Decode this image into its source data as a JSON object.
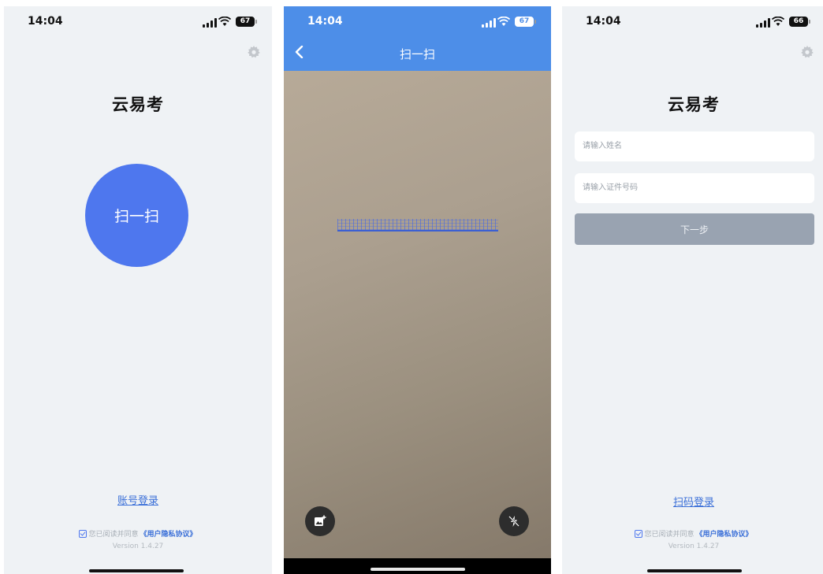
{
  "status_bar": [
    {
      "time": "14:04",
      "battery": "67"
    },
    {
      "time": "14:04",
      "battery": "67"
    },
    {
      "time": "14:04",
      "battery": "66"
    }
  ],
  "screen_home": {
    "app_title": "云易考",
    "scan_button": "扫一扫",
    "account_login": "账号登录",
    "agreement_text": "您已阅读并同意",
    "agreement_link": "《用户隐私协议》",
    "version": "Version 1.4.27"
  },
  "screen_scan": {
    "title": "扫一扫",
    "accent": "#4d8ee8"
  },
  "screen_login": {
    "app_title": "云易考",
    "name_placeholder": "请输入姓名",
    "id_placeholder": "请输入证件号码",
    "next_button": "下一步",
    "scan_login": "扫码登录",
    "agreement_text": "您已阅读并同意",
    "agreement_link": "《用户隐私协议》",
    "version": "Version 1.4.27"
  },
  "icons": [
    "gear-icon",
    "back-icon",
    "gallery-icon",
    "flash-off-icon",
    "checkbox-icon",
    "signal-icon",
    "wifi-icon",
    "battery-icon"
  ],
  "colors": {
    "primary": "#4e77ee",
    "link": "#3a6fd8",
    "background": "#eff2f5",
    "disabled_button": "#99a3b1"
  }
}
